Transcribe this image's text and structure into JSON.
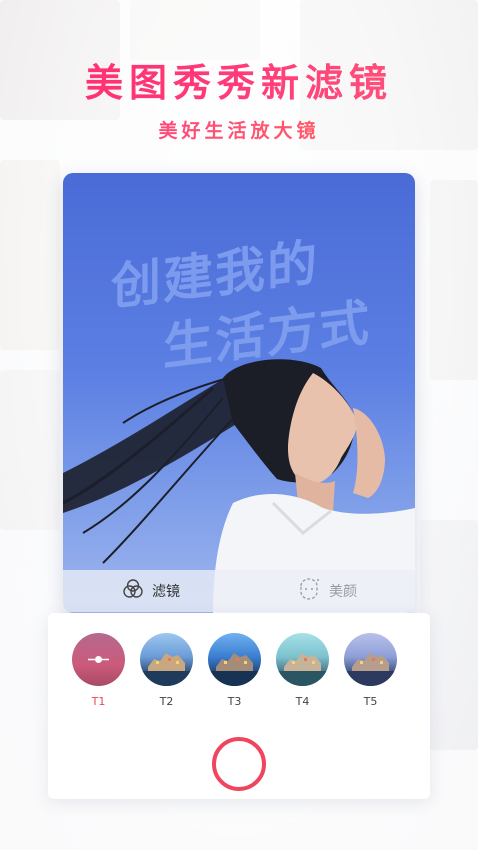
{
  "header": {
    "title": "美图秀秀新滤镜",
    "subtitle": "美好生活放大镜"
  },
  "photo": {
    "overlay_line1": "创建我的",
    "overlay_line2": "生活方式"
  },
  "modes": [
    {
      "label": "滤镜",
      "icon": "filter-circles-icon",
      "active": true
    },
    {
      "label": "美颜",
      "icon": "face-beauty-icon",
      "active": false
    }
  ],
  "filters": [
    {
      "label": "T1",
      "selected": true
    },
    {
      "label": "T2",
      "selected": false
    },
    {
      "label": "T3",
      "selected": false
    },
    {
      "label": "T4",
      "selected": false
    },
    {
      "label": "T5",
      "selected": false
    }
  ],
  "colors": {
    "accent": "#f0455e",
    "title_gradient_start": "#ff2b6e",
    "card_blue": "#4a6bd6"
  }
}
